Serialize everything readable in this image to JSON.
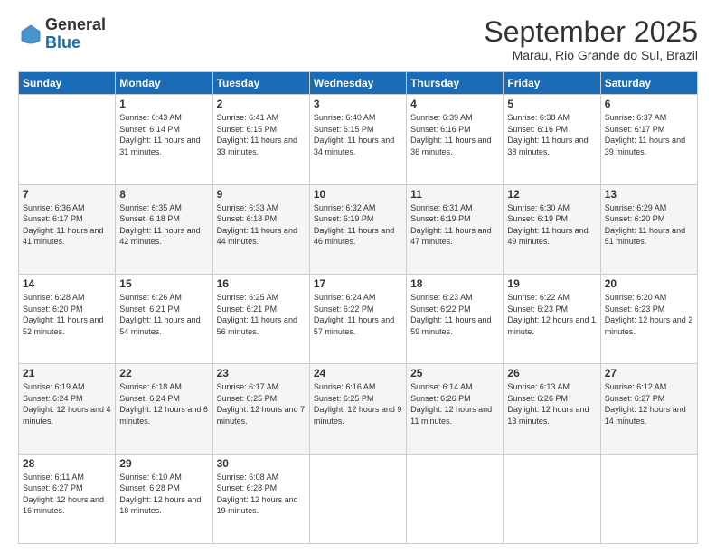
{
  "logo": {
    "general": "General",
    "blue": "Blue"
  },
  "title": "September 2025",
  "subtitle": "Marau, Rio Grande do Sul, Brazil",
  "days": [
    "Sunday",
    "Monday",
    "Tuesday",
    "Wednesday",
    "Thursday",
    "Friday",
    "Saturday"
  ],
  "weeks": [
    [
      {
        "day": "",
        "sunrise": "",
        "sunset": "",
        "daylight": ""
      },
      {
        "day": "1",
        "sunrise": "Sunrise: 6:43 AM",
        "sunset": "Sunset: 6:14 PM",
        "daylight": "Daylight: 11 hours and 31 minutes."
      },
      {
        "day": "2",
        "sunrise": "Sunrise: 6:41 AM",
        "sunset": "Sunset: 6:15 PM",
        "daylight": "Daylight: 11 hours and 33 minutes."
      },
      {
        "day": "3",
        "sunrise": "Sunrise: 6:40 AM",
        "sunset": "Sunset: 6:15 PM",
        "daylight": "Daylight: 11 hours and 34 minutes."
      },
      {
        "day": "4",
        "sunrise": "Sunrise: 6:39 AM",
        "sunset": "Sunset: 6:16 PM",
        "daylight": "Daylight: 11 hours and 36 minutes."
      },
      {
        "day": "5",
        "sunrise": "Sunrise: 6:38 AM",
        "sunset": "Sunset: 6:16 PM",
        "daylight": "Daylight: 11 hours and 38 minutes."
      },
      {
        "day": "6",
        "sunrise": "Sunrise: 6:37 AM",
        "sunset": "Sunset: 6:17 PM",
        "daylight": "Daylight: 11 hours and 39 minutes."
      }
    ],
    [
      {
        "day": "7",
        "sunrise": "Sunrise: 6:36 AM",
        "sunset": "Sunset: 6:17 PM",
        "daylight": "Daylight: 11 hours and 41 minutes."
      },
      {
        "day": "8",
        "sunrise": "Sunrise: 6:35 AM",
        "sunset": "Sunset: 6:18 PM",
        "daylight": "Daylight: 11 hours and 42 minutes."
      },
      {
        "day": "9",
        "sunrise": "Sunrise: 6:33 AM",
        "sunset": "Sunset: 6:18 PM",
        "daylight": "Daylight: 11 hours and 44 minutes."
      },
      {
        "day": "10",
        "sunrise": "Sunrise: 6:32 AM",
        "sunset": "Sunset: 6:19 PM",
        "daylight": "Daylight: 11 hours and 46 minutes."
      },
      {
        "day": "11",
        "sunrise": "Sunrise: 6:31 AM",
        "sunset": "Sunset: 6:19 PM",
        "daylight": "Daylight: 11 hours and 47 minutes."
      },
      {
        "day": "12",
        "sunrise": "Sunrise: 6:30 AM",
        "sunset": "Sunset: 6:19 PM",
        "daylight": "Daylight: 11 hours and 49 minutes."
      },
      {
        "day": "13",
        "sunrise": "Sunrise: 6:29 AM",
        "sunset": "Sunset: 6:20 PM",
        "daylight": "Daylight: 11 hours and 51 minutes."
      }
    ],
    [
      {
        "day": "14",
        "sunrise": "Sunrise: 6:28 AM",
        "sunset": "Sunset: 6:20 PM",
        "daylight": "Daylight: 11 hours and 52 minutes."
      },
      {
        "day": "15",
        "sunrise": "Sunrise: 6:26 AM",
        "sunset": "Sunset: 6:21 PM",
        "daylight": "Daylight: 11 hours and 54 minutes."
      },
      {
        "day": "16",
        "sunrise": "Sunrise: 6:25 AM",
        "sunset": "Sunset: 6:21 PM",
        "daylight": "Daylight: 11 hours and 56 minutes."
      },
      {
        "day": "17",
        "sunrise": "Sunrise: 6:24 AM",
        "sunset": "Sunset: 6:22 PM",
        "daylight": "Daylight: 11 hours and 57 minutes."
      },
      {
        "day": "18",
        "sunrise": "Sunrise: 6:23 AM",
        "sunset": "Sunset: 6:22 PM",
        "daylight": "Daylight: 11 hours and 59 minutes."
      },
      {
        "day": "19",
        "sunrise": "Sunrise: 6:22 AM",
        "sunset": "Sunset: 6:23 PM",
        "daylight": "Daylight: 12 hours and 1 minute."
      },
      {
        "day": "20",
        "sunrise": "Sunrise: 6:20 AM",
        "sunset": "Sunset: 6:23 PM",
        "daylight": "Daylight: 12 hours and 2 minutes."
      }
    ],
    [
      {
        "day": "21",
        "sunrise": "Sunrise: 6:19 AM",
        "sunset": "Sunset: 6:24 PM",
        "daylight": "Daylight: 12 hours and 4 minutes."
      },
      {
        "day": "22",
        "sunrise": "Sunrise: 6:18 AM",
        "sunset": "Sunset: 6:24 PM",
        "daylight": "Daylight: 12 hours and 6 minutes."
      },
      {
        "day": "23",
        "sunrise": "Sunrise: 6:17 AM",
        "sunset": "Sunset: 6:25 PM",
        "daylight": "Daylight: 12 hours and 7 minutes."
      },
      {
        "day": "24",
        "sunrise": "Sunrise: 6:16 AM",
        "sunset": "Sunset: 6:25 PM",
        "daylight": "Daylight: 12 hours and 9 minutes."
      },
      {
        "day": "25",
        "sunrise": "Sunrise: 6:14 AM",
        "sunset": "Sunset: 6:26 PM",
        "daylight": "Daylight: 12 hours and 11 minutes."
      },
      {
        "day": "26",
        "sunrise": "Sunrise: 6:13 AM",
        "sunset": "Sunset: 6:26 PM",
        "daylight": "Daylight: 12 hours and 13 minutes."
      },
      {
        "day": "27",
        "sunrise": "Sunrise: 6:12 AM",
        "sunset": "Sunset: 6:27 PM",
        "daylight": "Daylight: 12 hours and 14 minutes."
      }
    ],
    [
      {
        "day": "28",
        "sunrise": "Sunrise: 6:11 AM",
        "sunset": "Sunset: 6:27 PM",
        "daylight": "Daylight: 12 hours and 16 minutes."
      },
      {
        "day": "29",
        "sunrise": "Sunrise: 6:10 AM",
        "sunset": "Sunset: 6:28 PM",
        "daylight": "Daylight: 12 hours and 18 minutes."
      },
      {
        "day": "30",
        "sunrise": "Sunrise: 6:08 AM",
        "sunset": "Sunset: 6:28 PM",
        "daylight": "Daylight: 12 hours and 19 minutes."
      },
      {
        "day": "",
        "sunrise": "",
        "sunset": "",
        "daylight": ""
      },
      {
        "day": "",
        "sunrise": "",
        "sunset": "",
        "daylight": ""
      },
      {
        "day": "",
        "sunrise": "",
        "sunset": "",
        "daylight": ""
      },
      {
        "day": "",
        "sunrise": "",
        "sunset": "",
        "daylight": ""
      }
    ]
  ]
}
